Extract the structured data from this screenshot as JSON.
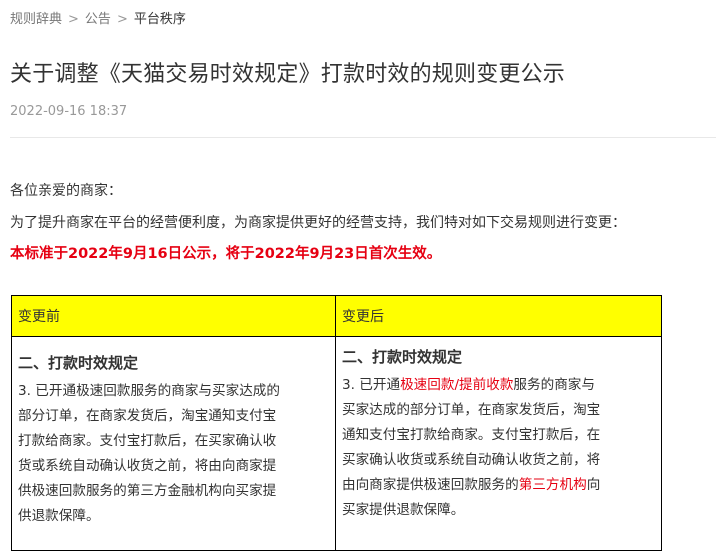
{
  "breadcrumb": {
    "items": [
      "规则辞典",
      "公告",
      "平台秩序"
    ],
    "separator": ">"
  },
  "article": {
    "title": "关于调整《天猫交易时效规定》打款时效的规则变更公示",
    "date": "2022-09-16 18:37",
    "greeting": "各位亲爱的商家：",
    "intro": "为了提升商家在平台的经营便利度，为商家提供更好的经营支持，我们特对如下交易规则进行变更：",
    "notice": "本标准于2022年9月16日公示，将于2022年9月23日首次生效。"
  },
  "table": {
    "header_before": "变更前",
    "header_after": "变更后",
    "before": {
      "heading": "二、打款时效规定",
      "lines": [
        "3. 已开通极速回款服务的商家与买家达成的",
        "部分订单，在商家发货后，淘宝通知支付宝",
        "打款给商家。支付宝打款后，在买家确认收",
        "货或系统自动确认收货之前，将由向商家提",
        "供极速回款服务的第三方金融机构向买家提",
        "供退款保障。"
      ]
    },
    "after": {
      "heading": "二、打款时效规定",
      "line1_prefix": "3. 已开通",
      "line1_highlight": "极速回款/提前收款",
      "line1_suffix": "服务的商家与",
      "line2": "买家达成的部分订单，在商家发货后，淘宝",
      "line3": "通知支付宝打款给商家。支付宝打款后，在",
      "line4": "买家确认收货或系统自动确认收货之前，将",
      "line5_prefix": "由向商家提供极速回款服务的",
      "line5_highlight": "第三方机构",
      "line5_suffix": "向",
      "line6": "买家提供退款保障。"
    }
  },
  "colors": {
    "highlight_red": "#e60012",
    "header_yellow": "#ffff00",
    "text": "#333333",
    "muted": "#999999"
  }
}
